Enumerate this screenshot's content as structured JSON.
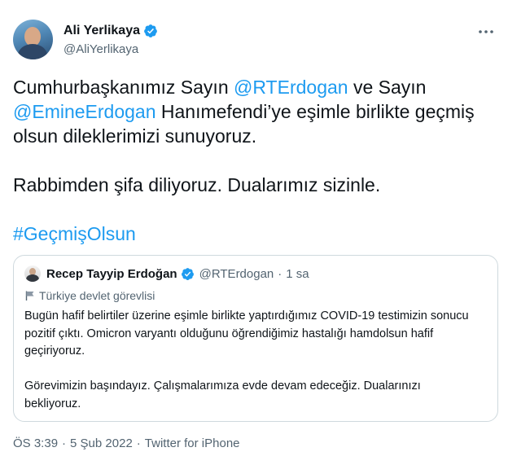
{
  "author": {
    "name": "Ali Yerlikaya",
    "handle": "@AliYerlikaya",
    "verified": true
  },
  "tweet": {
    "text_plain_1": "Cumhurbaşkanımız Sayın ",
    "mention_1": "@RTErdogan",
    "text_plain_2": " ve Sayın ",
    "mention_2": "@EmineErdogan",
    "text_plain_3": " Hanımefendi’ye eşimle birlikte geçmiş olsun dileklerimizi sunuyoruz.\n\nRabbimden şifa diliyoruz. Dualarımız sizinle.\n\n",
    "hashtag": "#GeçmişOlsun"
  },
  "quoted_tweet": {
    "name": "Recep Tayyip Erdoğan",
    "handle": "@RTErdogan",
    "separator": "·",
    "time": "1 sa",
    "label": "Türkiye devlet görevlisi",
    "text": "Bugün hafif belirtiler üzerine eşimle birlikte yaptırdığımız COVID-19 testimizin sonucu pozitif çıktı. Omicron varyantı olduğunu öğrendiğimiz hastalığı hamdolsun hafif geçiriyoruz.\n\nGörevimizin başındayız. Çalışmalarımıza evde devam edeceğiz. Dualarınızı bekliyoruz."
  },
  "meta": {
    "time": "ÖS 3:39",
    "separator": "·",
    "date": "5 Şub 2022",
    "source": "Twitter for iPhone"
  },
  "colors": {
    "accent": "#1d9bf0",
    "secondary_text": "#536471",
    "border": "#cfd9de"
  },
  "icons": [
    "verified-badge-icon",
    "more-options-icon",
    "government-flag-icon"
  ]
}
